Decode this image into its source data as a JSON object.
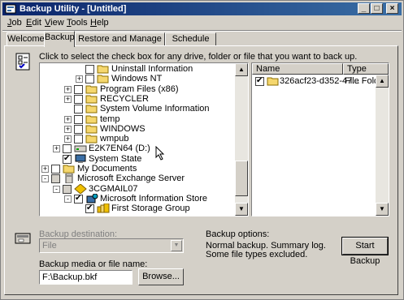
{
  "window": {
    "title": "Backup Utility - [Untitled]"
  },
  "title_buttons": {
    "minimize": "_",
    "maximize": "□",
    "close": "×"
  },
  "menu": [
    {
      "label": "Job",
      "accel": "J",
      "rest": "ob"
    },
    {
      "label": "Edit",
      "accel": "E",
      "rest": "dit"
    },
    {
      "label": "View",
      "accel": "V",
      "rest": "iew"
    },
    {
      "label": "Tools",
      "accel": "T",
      "rest": "ools"
    },
    {
      "label": "Help",
      "accel": "H",
      "rest": "elp"
    }
  ],
  "tabs": [
    {
      "label": "Welcome",
      "active": false
    },
    {
      "label": "Backup",
      "active": true
    },
    {
      "label": "Restore and Manage Media",
      "active": false
    },
    {
      "label": "Schedule Jobs",
      "active": false
    }
  ],
  "instruction": "Click to select the check box for any drive, folder or file that you want to back up.",
  "tree": [
    {
      "label": "Uninstall Information",
      "level": 3,
      "expander": "",
      "checked": false,
      "icon": "folder-icon"
    },
    {
      "label": "Windows NT",
      "level": 3,
      "expander": "+",
      "checked": false,
      "icon": "folder-icon"
    },
    {
      "label": "Program Files (x86)",
      "level": 2,
      "expander": "+",
      "checked": false,
      "icon": "folder-icon"
    },
    {
      "label": "RECYCLER",
      "level": 2,
      "expander": "+",
      "checked": false,
      "icon": "folder-icon"
    },
    {
      "label": "System Volume Information",
      "level": 2,
      "expander": "",
      "checked": false,
      "icon": "folder-icon"
    },
    {
      "label": "temp",
      "level": 2,
      "expander": "+",
      "checked": false,
      "icon": "folder-icon"
    },
    {
      "label": "WINDOWS",
      "level": 2,
      "expander": "+",
      "checked": false,
      "icon": "folder-icon"
    },
    {
      "label": "wmpub",
      "level": 2,
      "expander": "+",
      "checked": false,
      "icon": "folder-icon"
    },
    {
      "label": "E2K7EN64 (D:)",
      "level": 1,
      "expander": "+",
      "checked": false,
      "icon": "drive-icon"
    },
    {
      "label": "System State",
      "level": 1,
      "expander": "",
      "checked": true,
      "icon": "computer-icon"
    },
    {
      "label": "My Documents",
      "level": 0,
      "expander": "+",
      "checked": false,
      "icon": "folder-icon"
    },
    {
      "label": "Microsoft Exchange Server",
      "level": 0,
      "expander": "-",
      "checked": false,
      "grayed": true,
      "icon": "server-icon"
    },
    {
      "label": "3CGMAIL07",
      "level": 1,
      "expander": "-",
      "checked": false,
      "grayed": true,
      "icon": "exchange-icon"
    },
    {
      "label": "Microsoft Information Store",
      "level": 2,
      "expander": "-",
      "checked": true,
      "icon": "store-icon"
    },
    {
      "label": "First Storage Group",
      "level": 3,
      "expander": "",
      "checked": true,
      "icon": "storage-group-icon"
    }
  ],
  "list": {
    "columns": [
      "Name",
      "Type"
    ],
    "rows": [
      {
        "name": "326acf23-d352-47...",
        "type": "File Folder",
        "checked": true
      }
    ]
  },
  "backup_destination": {
    "label": "Backup destination:",
    "value": "File"
  },
  "backup_options": {
    "label": "Backup options:",
    "line1": "Normal backup.  Summary log.",
    "line2": "Some file types excluded."
  },
  "media": {
    "label": "Backup media or file name:",
    "value": "F:\\Backup.bkf"
  },
  "buttons": {
    "browse": "Browse...",
    "start": "Start Backup"
  },
  "colors": {
    "title_start": "#0a246a",
    "title_end": "#3a6ea5",
    "face": "#d4d0c8",
    "folder": "#f5d76e"
  }
}
